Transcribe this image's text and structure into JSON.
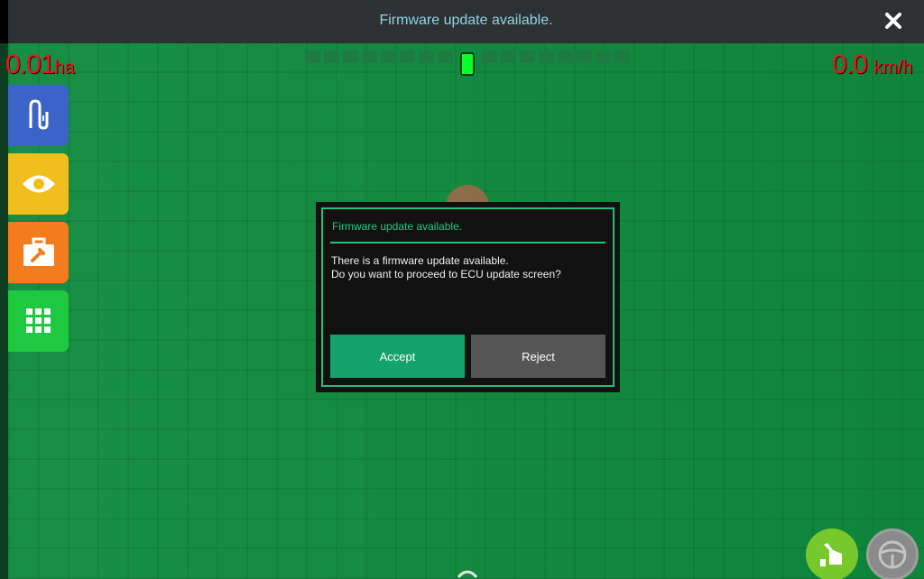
{
  "topbar": {
    "title": "Firmware update available.",
    "close_icon": "close-icon"
  },
  "readouts": {
    "area_value": "0.01",
    "area_unit": "ha",
    "speed_value": "0.0",
    "speed_unit": "km/h"
  },
  "side_menu": [
    {
      "icon": "tracking-icon",
      "color": "#3c64c8"
    },
    {
      "icon": "eye-icon",
      "color": "#f0be1d"
    },
    {
      "icon": "toolbox-icon",
      "color": "#f47c1c"
    },
    {
      "icon": "apps-grid-icon",
      "color": "#1ec840"
    }
  ],
  "dialog": {
    "title": "Firmware update available.",
    "line1": "There is a firmware update available.",
    "line2": "Do you want to proceed to ECU update screen?",
    "accept_label": "Accept",
    "reject_label": "Reject",
    "accent_color": "#23c07a"
  },
  "bottom_controls": [
    {
      "icon": "autopilot-hand-icon",
      "color": "#77c82d"
    },
    {
      "icon": "steering-wheel-icon",
      "color": "#8a8a8a"
    }
  ]
}
